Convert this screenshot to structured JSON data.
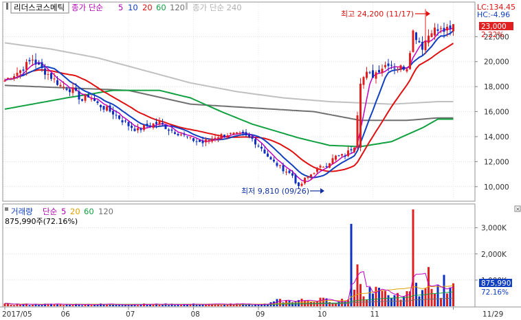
{
  "header": {
    "stock_name": "리더스코스메틱",
    "price_label": "종가 단순",
    "ma_periods": [
      "5",
      "10",
      "20",
      "60",
      "120"
    ],
    "ma240_label": "종가 단순 240",
    "lc_label": "LC:134.45",
    "hc_label": "HC:-4.96"
  },
  "volume_header": {
    "title": "거래량",
    "simple_label": "단순",
    "ma_periods": [
      "5",
      "20",
      "60",
      "120"
    ],
    "last_volume": "875,990주(72.16%)"
  },
  "annotations": {
    "high": "최고 24,200 (11/17)",
    "low": "최저 9,810 (09/26)"
  },
  "current": {
    "price": "23,000",
    "change": "2.22%",
    "volume": "875,990",
    "volume_pct": "72.16%"
  },
  "colors": {
    "up": "#e02020",
    "down": "#1030c0",
    "ma5": "#c000c0",
    "ma10": "#1040c0",
    "ma20": "#e01010",
    "ma60": "#10a040",
    "ma120": "#707070",
    "ma240": "#c0c0c0",
    "vol_ma5": "#c000c0",
    "vol_ma20": "#e0a000",
    "vol_ma60": "#10a040",
    "vol_ma120": "#707070"
  },
  "chart_data": {
    "type": "candlestick",
    "price_axis": {
      "ticks": [
        10000,
        12000,
        14000,
        16000,
        18000,
        20000,
        22000
      ],
      "tick_labels": [
        "10,000",
        "12,000",
        "14,000",
        "16,000",
        "18,000",
        "20,000",
        "22,000"
      ],
      "ylim": [
        9000,
        24600
      ]
    },
    "volume_axis": {
      "ticks": [
        1000000,
        2000000,
        3000000
      ],
      "tick_labels": [
        "1,000K",
        "2,000K",
        "3,000K"
      ],
      "ylim": [
        0,
        3700000
      ]
    },
    "x_labels": [
      "2017/05",
      "06",
      "07",
      "08",
      "09",
      "10",
      "11",
      "11/29"
    ],
    "x_label_index": [
      0,
      19,
      40,
      61,
      82,
      102,
      119,
      145
    ],
    "close_anchors": [
      [
        0,
        18500
      ],
      [
        5,
        19300
      ],
      [
        9,
        20200
      ],
      [
        11,
        19600
      ],
      [
        14,
        19000
      ],
      [
        18,
        18100
      ],
      [
        22,
        17700
      ],
      [
        25,
        16900
      ],
      [
        27,
        17300
      ],
      [
        30,
        16600
      ],
      [
        35,
        15900
      ],
      [
        40,
        14900
      ],
      [
        43,
        14500
      ],
      [
        46,
        14900
      ],
      [
        50,
        15100
      ],
      [
        53,
        14600
      ],
      [
        57,
        14200
      ],
      [
        60,
        13800
      ],
      [
        64,
        13500
      ],
      [
        68,
        14000
      ],
      [
        72,
        14200
      ],
      [
        77,
        14100
      ],
      [
        80,
        13800
      ],
      [
        83,
        13100
      ],
      [
        86,
        12100
      ],
      [
        90,
        11400
      ],
      [
        93,
        10900
      ],
      [
        95,
        9900
      ],
      [
        97,
        10600
      ],
      [
        101,
        11400
      ],
      [
        104,
        11800
      ],
      [
        107,
        12400
      ],
      [
        110,
        12500
      ],
      [
        113,
        13300
      ],
      [
        115,
        18500
      ],
      [
        117,
        19000
      ],
      [
        119,
        18900
      ],
      [
        121,
        19400
      ],
      [
        124,
        19900
      ],
      [
        127,
        19500
      ],
      [
        130,
        19600
      ],
      [
        132,
        22400
      ],
      [
        135,
        21200
      ],
      [
        138,
        22600
      ],
      [
        140,
        22500
      ]
    ],
    "ma240_anchors": [
      [
        0,
        21500
      ],
      [
        15,
        21000
      ],
      [
        30,
        20300
      ],
      [
        45,
        19300
      ],
      [
        60,
        18300
      ],
      [
        75,
        17600
      ],
      [
        90,
        17100
      ],
      [
        105,
        16800
      ],
      [
        115,
        16700
      ],
      [
        125,
        16600
      ],
      [
        140,
        16800
      ]
    ],
    "ma120_anchors": [
      [
        0,
        18100
      ],
      [
        20,
        17900
      ],
      [
        40,
        17700
      ],
      [
        60,
        16600
      ],
      [
        80,
        16300
      ],
      [
        100,
        16000
      ],
      [
        115,
        15300
      ],
      [
        130,
        15300
      ],
      [
        140,
        15500
      ]
    ],
    "ma60_anchors": [
      [
        0,
        16200
      ],
      [
        20,
        17100
      ],
      [
        35,
        17700
      ],
      [
        50,
        17700
      ],
      [
        60,
        17100
      ],
      [
        70,
        16000
      ],
      [
        80,
        15000
      ],
      [
        95,
        13900
      ],
      [
        105,
        13300
      ],
      [
        115,
        13200
      ],
      [
        125,
        13600
      ],
      [
        135,
        14700
      ],
      [
        140,
        15400
      ]
    ],
    "volume_ma_levels": {
      "ma20": 150000,
      "ma60": 110000,
      "ma120": 90000
    },
    "high": {
      "index": 136,
      "value": 24200,
      "date": "11/17"
    },
    "low": {
      "index": 95,
      "value": 9810,
      "date": "09/26"
    },
    "last": {
      "price": 23000,
      "volume": 875990
    }
  }
}
